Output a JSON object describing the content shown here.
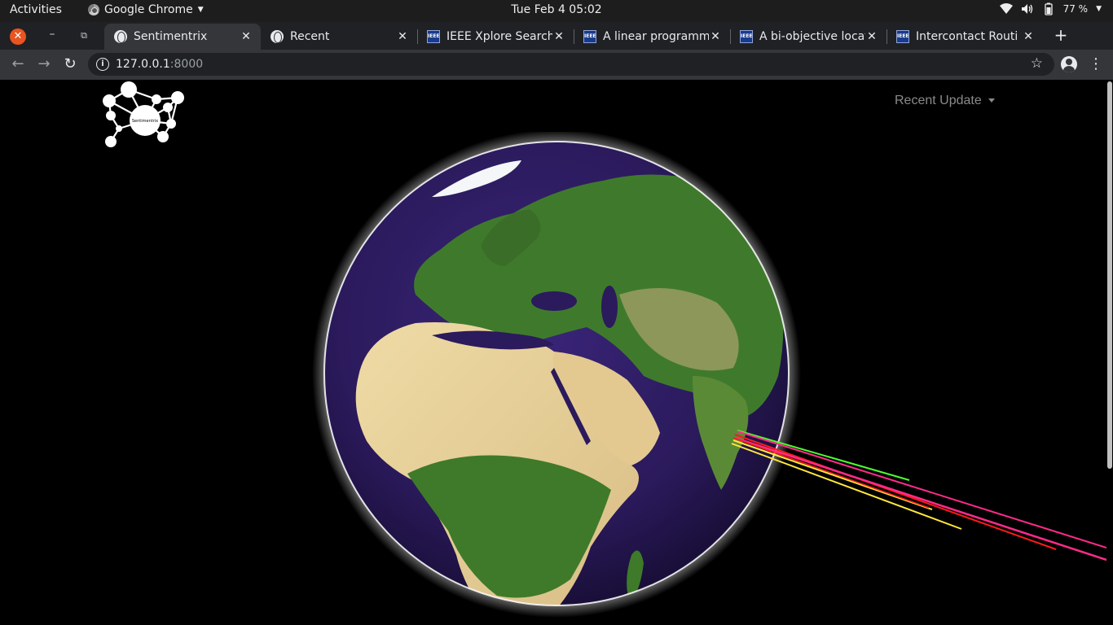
{
  "topbar": {
    "activities": "Activities",
    "app_name": "Google Chrome",
    "clock": "Tue Feb 4  05:02",
    "battery": "77 %"
  },
  "tabs": [
    {
      "title": "Sentimentrix",
      "icon": "globe-icon"
    },
    {
      "title": "Recent",
      "icon": "globe-icon"
    },
    {
      "title": "IEEE Xplore Search",
      "icon": "ieee-icon"
    },
    {
      "title": "A linear programm",
      "icon": "ieee-icon"
    },
    {
      "title": "A bi-objective locat",
      "icon": "ieee-icon"
    },
    {
      "title": "Intercontact Routi",
      "icon": "ieee-icon"
    }
  ],
  "address": {
    "host": "127.0.0.1",
    "port": ":8000"
  },
  "page": {
    "logo_text": "Sentimentrix",
    "nav_dropdown": "Recent Update"
  },
  "colors": {
    "arc_green": "#4cff2f",
    "arc_red": "#ff1a1a",
    "arc_magenta": "#ff2b8a",
    "arc_yellow": "#ffe83a",
    "ocean": "#2b1a5c",
    "halo": "#ffffff"
  }
}
